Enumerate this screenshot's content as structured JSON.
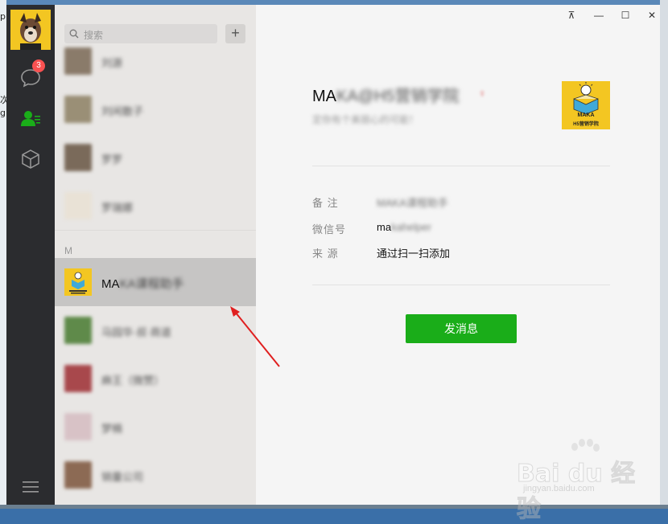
{
  "desktop": {
    "frag_1": "p",
    "frag_2": "次",
    "frag_3": "g"
  },
  "nav": {
    "chat_badge": "3"
  },
  "search": {
    "placeholder": "搜索",
    "add_label": "+"
  },
  "contacts": {
    "section_letter": "M",
    "rows_above": [
      {
        "name": "刘源",
        "avatar_color": "#8a7b6a"
      },
      {
        "name": "刘闲散子",
        "avatar_color": "#9a8f76"
      },
      {
        "name": "罗罗",
        "avatar_color": "#7a6a5a"
      },
      {
        "name": "罗瑞娜",
        "avatar_color": "#e9e2d6"
      }
    ],
    "selected": {
      "name_visible": "MA",
      "name_blurred": "KA课程助手",
      "avatar_color": "#f3c622"
    },
    "rows_below": [
      {
        "name": "马园华·叔·商道",
        "avatar_color": "#5f8a4a"
      },
      {
        "name": "麻王（微赞）",
        "avatar_color": "#a8484c"
      },
      {
        "name": "梦楠",
        "avatar_color": "#d8c2c6"
      },
      {
        "name": "销量公司",
        "avatar_color": "#8c6a54"
      }
    ]
  },
  "window_controls": {
    "pin": "⊼",
    "minimize": "—",
    "maximize": "☐",
    "close": "✕"
  },
  "profile": {
    "name_visible": "MA",
    "name_blurred": "KA@H5营销学院",
    "gender": "♀",
    "signature": "定你有个美丽心的可能！",
    "logo_text_1": "MAKA",
    "logo_text_2": "H5营销学院",
    "fields": [
      {
        "label": "备 注",
        "value_visible": "",
        "value_blurred": "MAKA课程助手"
      },
      {
        "label": "微信号",
        "value_visible": "ma",
        "value_blurred": "kahelper"
      },
      {
        "label": "来 源",
        "value_visible": "通过扫一扫添加",
        "value_blurred": ""
      }
    ],
    "send_button": "发消息"
  },
  "watermark": {
    "brand": "Bai du 经验",
    "url": "jingyan.baidu.com"
  },
  "colors": {
    "accent_green": "#1aad19",
    "nav_bg": "#2b2c2f",
    "badge_red": "#fa5151",
    "arrow_red": "#e02020"
  }
}
